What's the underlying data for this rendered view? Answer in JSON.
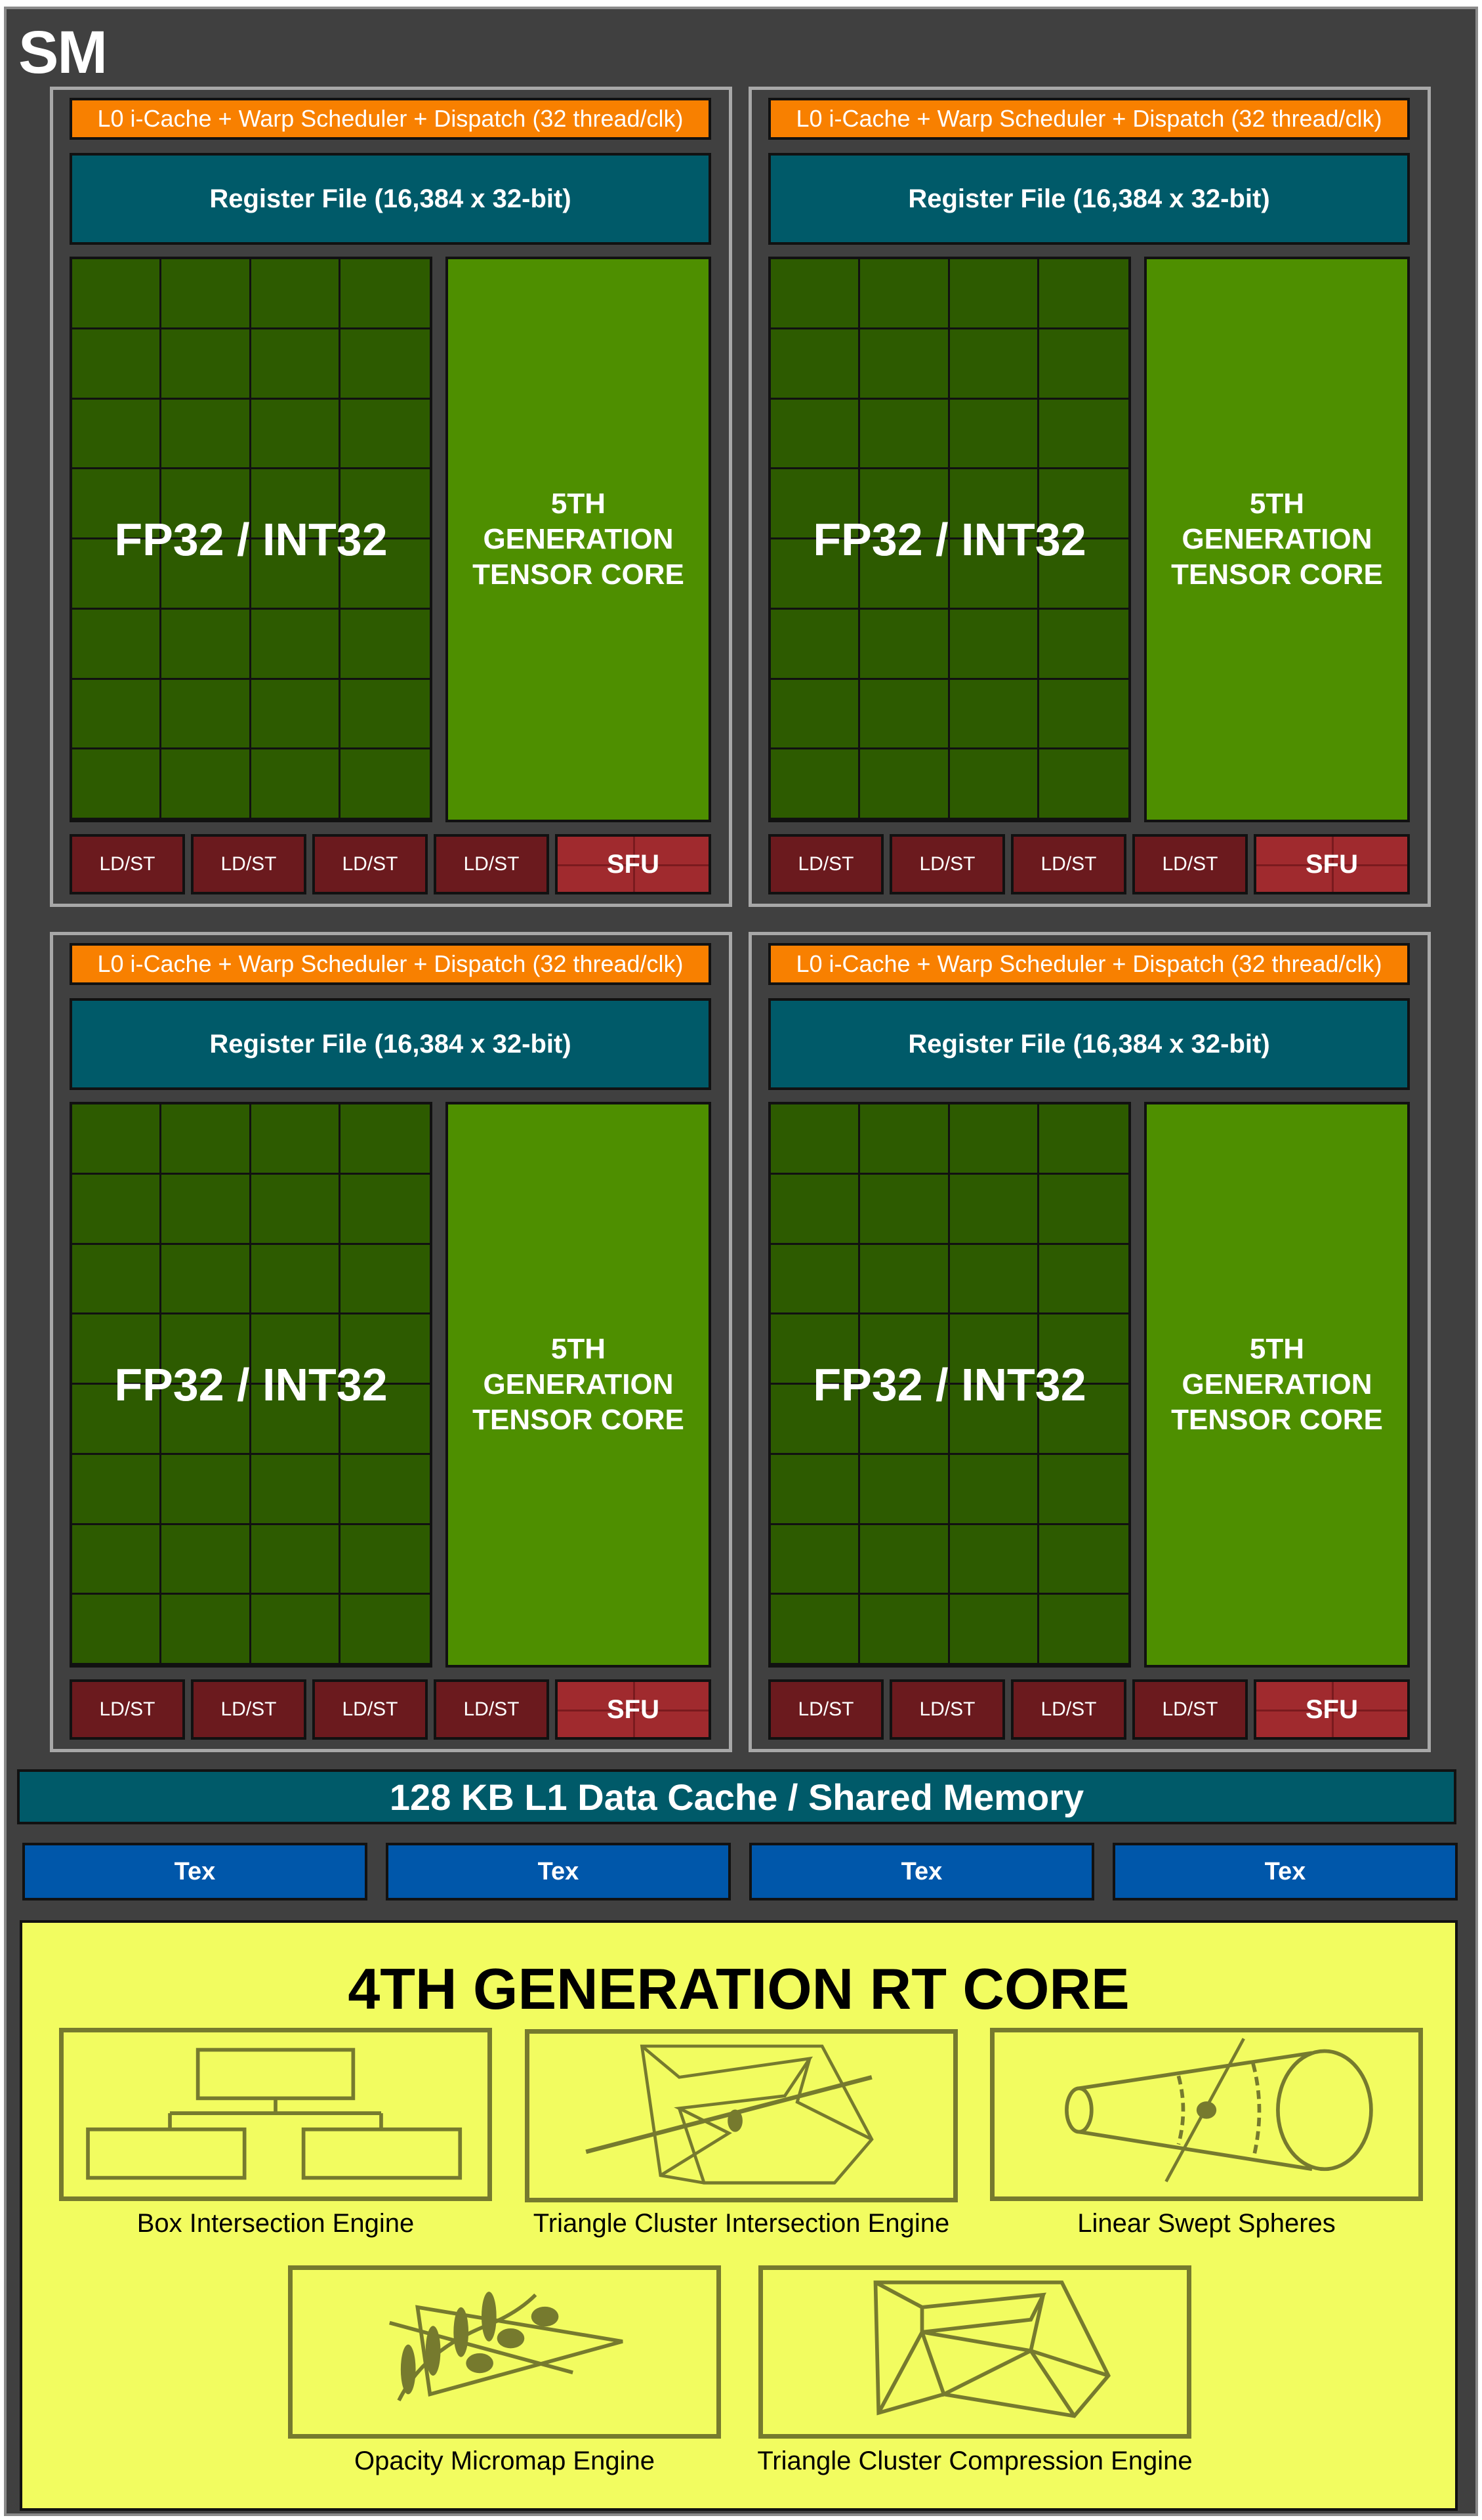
{
  "sm": {
    "title": "SM"
  },
  "partition": {
    "scheduler": "L0 i-Cache + Warp Scheduler + Dispatch (32 thread/clk)",
    "register_file": "Register File (16,384 x 32-bit)",
    "fp32": "FP32 / INT32",
    "tensor": "5TH\nGENERATION\nTENSOR CORE",
    "ldst": "LD/ST",
    "sfu": "SFU"
  },
  "l1": "128 KB L1 Data Cache / Shared Memory",
  "tex": [
    "Tex",
    "Tex",
    "Tex",
    "Tex"
  ],
  "rt_core": {
    "title": "4TH GENERATION RT CORE",
    "engines": [
      {
        "label": "Box Intersection Engine",
        "icon": "box-hierarchy-icon"
      },
      {
        "label": "Triangle Cluster Intersection Engine",
        "icon": "triangle-mesh-ray-icon"
      },
      {
        "label": "Linear Swept Spheres",
        "icon": "swept-sphere-icon"
      },
      {
        "label": "Opacity Micromap Engine",
        "icon": "leaf-triangle-icon"
      },
      {
        "label": "Triangle Cluster Compression Engine",
        "icon": "triangle-mesh-icon"
      }
    ]
  },
  "colors": {
    "background": "#404040",
    "scheduler": "#f88000",
    "register_file": "#005a69",
    "fp32": "#2d5b00",
    "tensor": "#4e8f00",
    "ldst": "#6b1a1e",
    "sfu": "#a02a2e",
    "tex": "#0057aa",
    "rt_core": "#f2fc60",
    "rt_icon": "#767a2e"
  }
}
